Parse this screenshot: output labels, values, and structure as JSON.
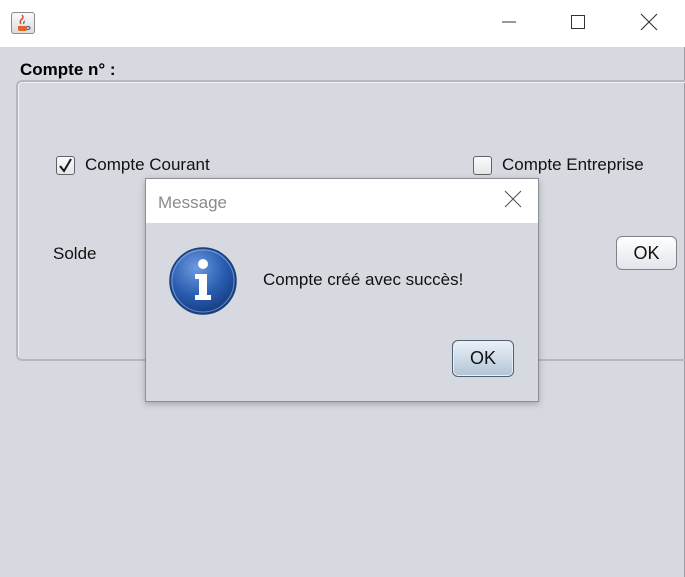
{
  "window": {
    "title": "",
    "icon": "java-cup-icon",
    "controls": [
      "minimize-icon",
      "maximize-icon",
      "close-icon"
    ]
  },
  "form": {
    "section_label": "Compte n° :",
    "checkbox_courant": {
      "label": "Compte Courant",
      "checked": true
    },
    "checkbox_entreprise": {
      "label": "Compte Entreprise",
      "checked": false
    },
    "solde_label": "Solde",
    "ok_button": "OK"
  },
  "dialog": {
    "title": "Message",
    "message": "Compte créé avec succès!",
    "icon": "information-icon",
    "ok_button": "OK"
  },
  "colors": {
    "window_bg": "#d6d9df",
    "info_icon_blue": "#2a5db0"
  }
}
